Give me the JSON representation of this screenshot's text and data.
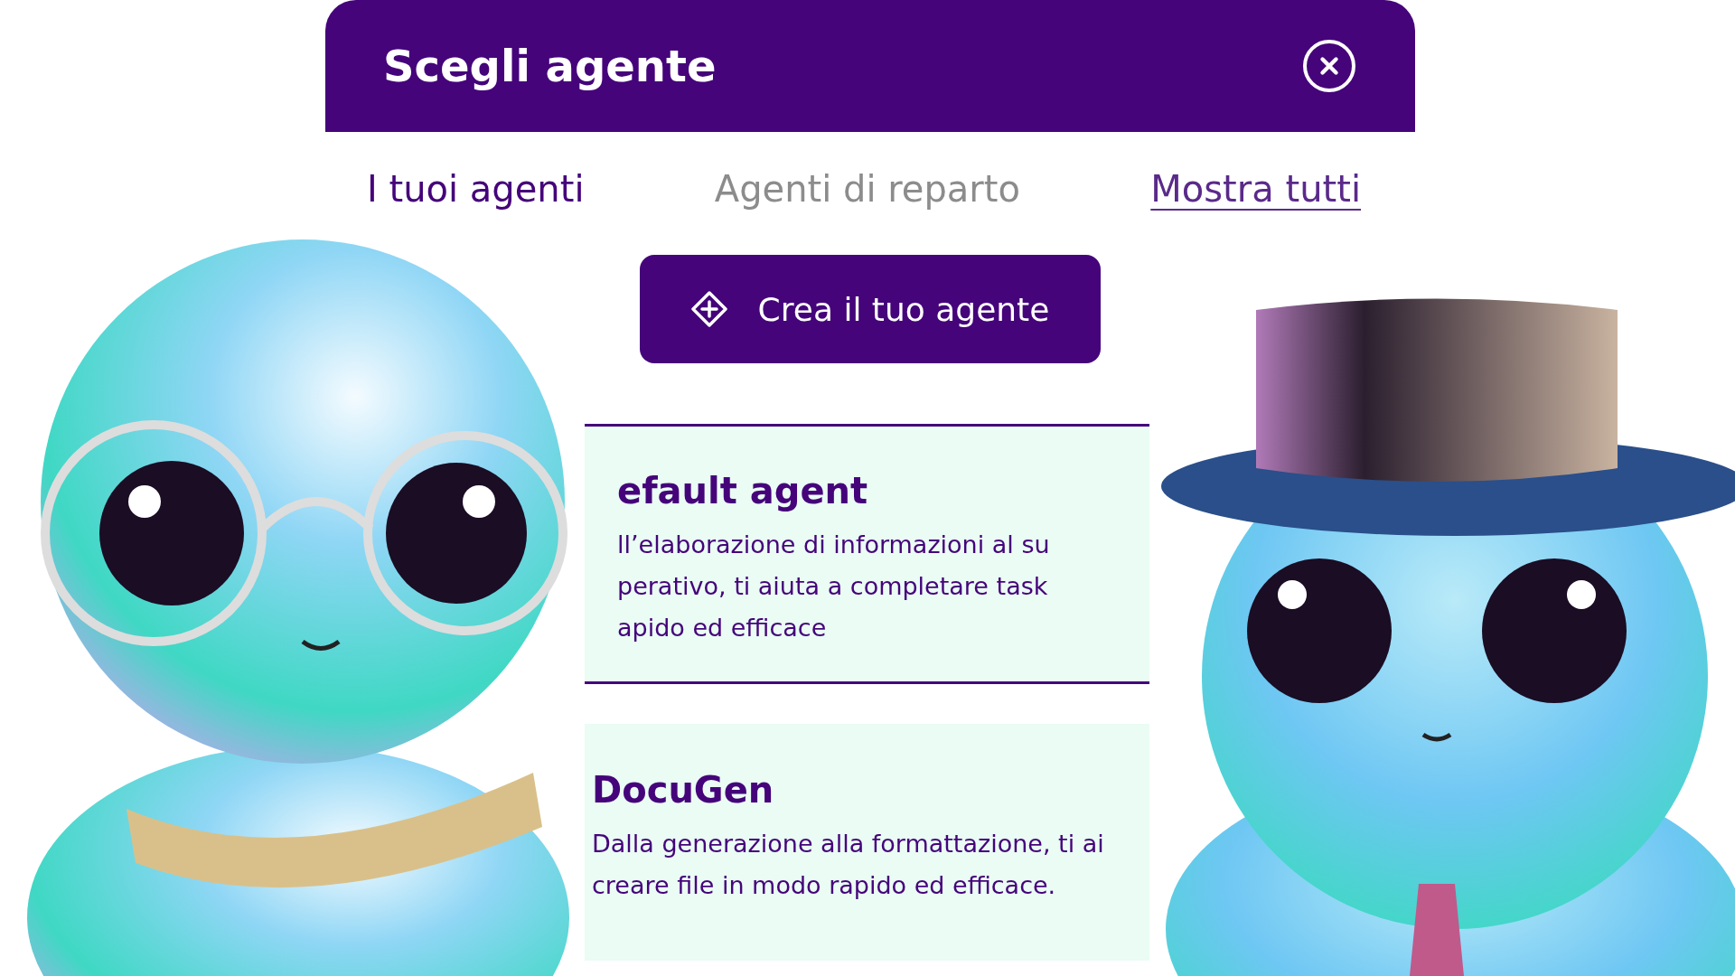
{
  "dialog": {
    "title": "Scegli agente"
  },
  "tabs": [
    {
      "kind": "tab",
      "label": "I tuoi agenti",
      "selected": true
    },
    {
      "kind": "tab",
      "label": "Agenti di reparto",
      "selected": false
    },
    {
      "kind": "link",
      "label": "Mostra tutti",
      "selected": false
    }
  ],
  "create_button": {
    "label": "Crea il tuo agente"
  },
  "agents": [
    {
      "name": "efault agent",
      "description_lines": [
        "ll’elaborazione di informazioni al su",
        "perativo, ti aiuta a completare task",
        "apido ed efficace"
      ],
      "bordered": true
    },
    {
      "name": "DocuGen",
      "description_lines": [
        "Dalla generazione alla formattazione, ti ai",
        "creare file in modo rapido ed efficace."
      ],
      "bordered": false
    }
  ]
}
